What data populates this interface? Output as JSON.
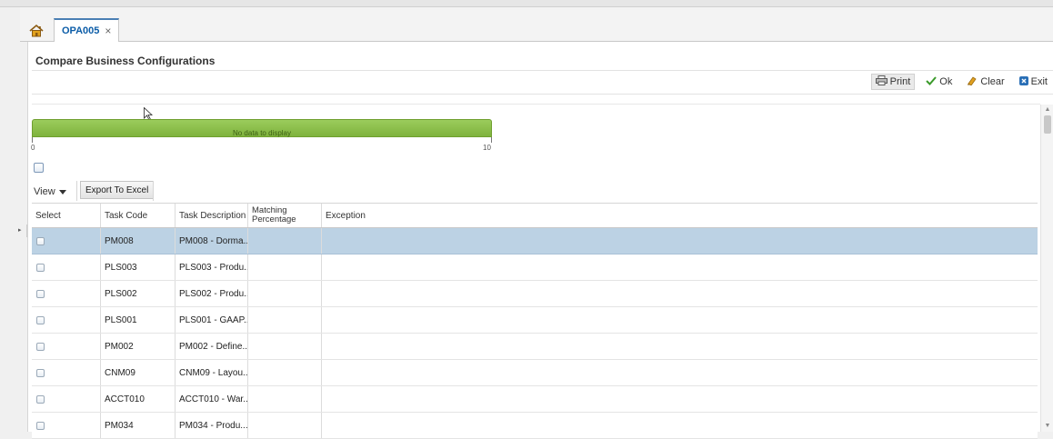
{
  "tabs": [
    {
      "label": "OPA005",
      "close_label": "×"
    }
  ],
  "page": {
    "title": "Compare Business Configurations"
  },
  "toolbar": {
    "print_label": "Print",
    "ok_label": "Ok",
    "clear_label": "Clear",
    "exit_label": "Exit"
  },
  "gauge": {
    "message": "No data to display",
    "min_label": "0",
    "max_label": "10"
  },
  "table_toolbar": {
    "view_label": "View",
    "export_label": "Export To Excel"
  },
  "table": {
    "headers": {
      "select": "Select",
      "task_code": "Task Code",
      "task_description": "Task Description",
      "matching_percentage": "Matching Percentage",
      "exception": "Exception"
    },
    "rows": [
      {
        "task_code": "PM008",
        "task_description": "PM008 - Dorma...",
        "selected": true
      },
      {
        "task_code": "PLS003",
        "task_description": "PLS003 - Produ...",
        "selected": false
      },
      {
        "task_code": "PLS002",
        "task_description": "PLS002 - Produ...",
        "selected": false
      },
      {
        "task_code": "PLS001",
        "task_description": "PLS001 - GAAP...",
        "selected": false
      },
      {
        "task_code": "PM002",
        "task_description": "PM002 - Define...",
        "selected": false
      },
      {
        "task_code": "CNM09",
        "task_description": "CNM09 - Layou...",
        "selected": false
      },
      {
        "task_code": "ACCT010",
        "task_description": "ACCT010 - War...",
        "selected": false
      },
      {
        "task_code": "PM034",
        "task_description": "PM034 - Produ...",
        "selected": false
      }
    ]
  },
  "colors": {
    "accent": "#0c5da8",
    "selected_row": "#bcd2e4",
    "gauge": "#8dbf48",
    "ok_check": "#3a9a2a",
    "clear_icon": "#e0a020",
    "exit_icon": "#2a6fb6"
  },
  "icons": {
    "home": "home-icon",
    "print": "printer-icon",
    "ok": "checkmark-icon",
    "clear": "eraser-icon",
    "exit": "exit-icon",
    "view_menu": "caret-down-icon"
  }
}
